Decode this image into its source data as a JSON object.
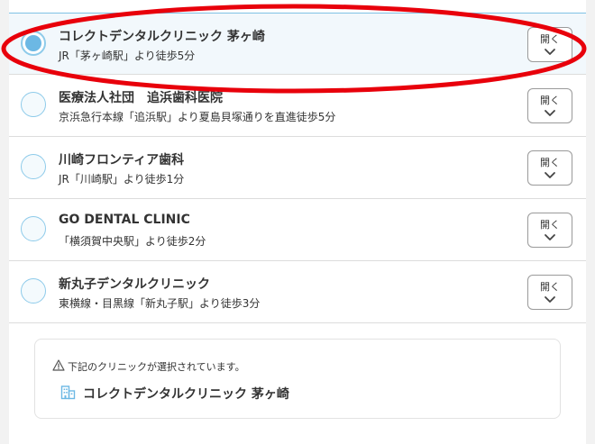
{
  "clinics": [
    {
      "name": "コレクトデンタルクリニック 茅ヶ崎",
      "access": "JR「茅ヶ崎駅」より徒歩5分",
      "open_label": "開く",
      "selected": true
    },
    {
      "name": "医療法人社団　追浜歯科医院",
      "access": "京浜急行本線「追浜駅」より夏島貝塚通りを直進徒歩5分",
      "open_label": "開く",
      "selected": false
    },
    {
      "name": "川崎フロンティア歯科",
      "access": "JR「川崎駅」より徒歩1分",
      "open_label": "開く",
      "selected": false
    },
    {
      "name": "GO DENTAL CLINIC",
      "access": "「横須賀中央駅」より徒歩2分",
      "open_label": "開く",
      "selected": false
    },
    {
      "name": "新丸子デンタルクリニック",
      "access": "東横線・目黒線「新丸子駅」より徒歩3分",
      "open_label": "開く",
      "selected": false
    }
  ],
  "notice": {
    "message": "下記のクリニックが選択されています。",
    "selected_clinic": "コレクトデンタルクリニック 茅ヶ崎",
    "icons": [
      "warning-icon",
      "building-icon"
    ]
  },
  "colors": {
    "accent": "#6cb8e4",
    "radio_border": "#8ecbea",
    "selected_row_bg": "#f2f8fc",
    "annotation": "#e8000b"
  }
}
